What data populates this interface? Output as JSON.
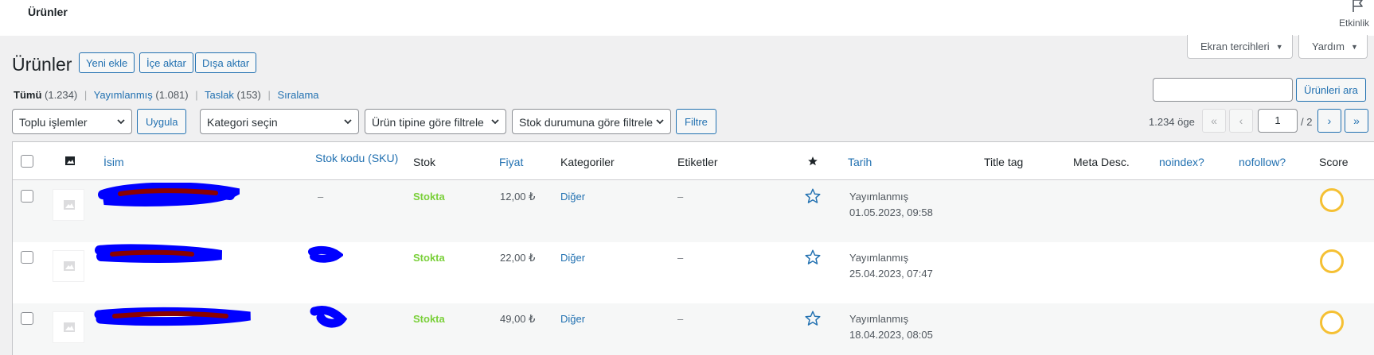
{
  "topbar": {
    "title": "Ürünler",
    "activity_label": "Etkinlik",
    "activity_icon": "flag-icon"
  },
  "screen_options": {
    "label": "Ekran tercihleri"
  },
  "help": {
    "label": "Yardım"
  },
  "heading": {
    "title": "Ürünler",
    "add_new": "Yeni ekle",
    "import": "İçe aktar",
    "export": "Dışa aktar"
  },
  "views": [
    {
      "label": "Tümü",
      "count": "(1.234)",
      "current": true
    },
    {
      "label": "Yayımlanmış",
      "count": "(1.081)"
    },
    {
      "label": "Taslak",
      "count": "(153)"
    },
    {
      "label": "Sıralama",
      "count": ""
    }
  ],
  "search": {
    "value": "",
    "button": "Ürünleri ara"
  },
  "filters": {
    "bulk_actions": "Toplu işlemler",
    "apply": "Uygula",
    "category": "Kategori seçin",
    "product_type": "Ürün tipine göre filtrele",
    "stock_status": "Stok durumuna göre filtrele",
    "filter_button": "Filtre"
  },
  "pagination": {
    "items": "1.234 öge",
    "first": "«",
    "prev": "‹",
    "current_page": "1",
    "total": "/ 2",
    "next": "›",
    "last": "»"
  },
  "columns": {
    "name": "İsim",
    "sku": "Stok kodu (SKU)",
    "stock": "Stok",
    "price": "Fiyat",
    "categories": "Kategoriler",
    "tags": "Etiketler",
    "date": "Tarih",
    "title_tag": "Title tag",
    "meta_desc": "Meta Desc.",
    "noindex": "noindex?",
    "nofollow": "nofollow?",
    "score": "Score"
  },
  "rows": [
    {
      "sku": "–",
      "stock": "Stokta",
      "price": "12,00 ₺",
      "category": "Diğer",
      "tags": "–",
      "status": "Yayımlanmış",
      "date": "01.05.2023, 09:58"
    },
    {
      "sku": "",
      "stock": "Stokta",
      "price": "22,00 ₺",
      "category": "Diğer",
      "tags": "–",
      "status": "Yayımlanmış",
      "date": "25.04.2023, 07:47"
    },
    {
      "sku": "",
      "stock": "Stokta",
      "price": "49,00 ₺",
      "category": "Diğer",
      "tags": "–",
      "status": "Yayımlanmış",
      "date": "18.04.2023, 08:05"
    }
  ],
  "colors": {
    "accent": "#2271b1",
    "in_stock": "#7ad03a",
    "score_ring": "#f5c033",
    "redaction_blue": "#0000ff",
    "redaction_red": "#8b0000"
  }
}
